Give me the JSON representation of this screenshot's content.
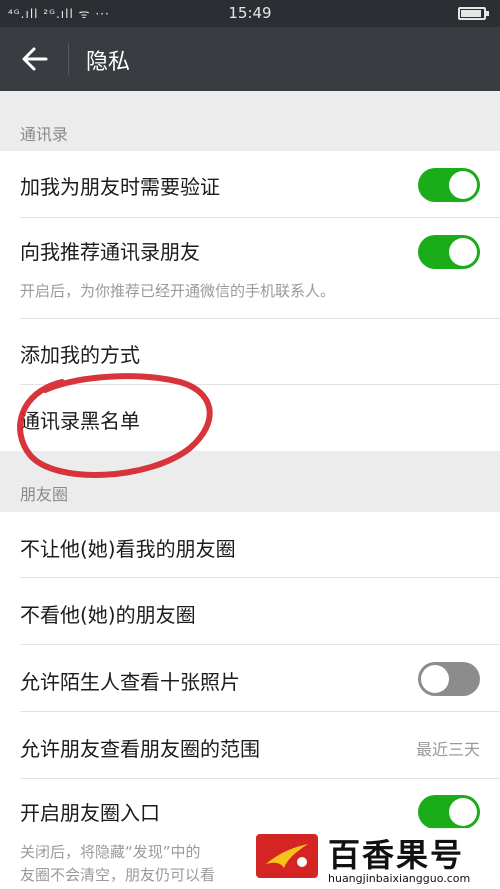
{
  "statusbar": {
    "signal_text": "⁴ᴳ.ıll ²ᴳ.ıll ᯤ ···",
    "time": "15:49"
  },
  "header": {
    "title": "隐私"
  },
  "sections": {
    "contacts": {
      "header": "通讯录",
      "items": [
        {
          "label": "加我为朋友时需要验证",
          "toggle": "on"
        },
        {
          "label": "向我推荐通讯录朋友",
          "toggle": "on",
          "sub": "开启后，为你推荐已经开通微信的手机联系人。"
        },
        {
          "label": "添加我的方式"
        },
        {
          "label": "通讯录黑名单"
        }
      ]
    },
    "moments": {
      "header": "朋友圈",
      "items": [
        {
          "label": "不让他(她)看我的朋友圈"
        },
        {
          "label": "不看他(她)的朋友圈"
        },
        {
          "label": "允许陌生人查看十张照片",
          "toggle": "off"
        },
        {
          "label": "允许朋友查看朋友圈的范围",
          "value": "最近三天"
        },
        {
          "label": "开启朋友圈入口",
          "toggle": "on",
          "sub1": "关闭后，将隐藏“发现”中的",
          "sub2": "友圈不会清空，朋友仍可以看"
        }
      ]
    }
  },
  "watermark": {
    "brand": "百香果号",
    "url": "huangjinbaixiangguo.com"
  },
  "colors": {
    "toggle_on": "#1aad19",
    "toggle_off": "#8c8c8c",
    "titlebar": "#393c40",
    "annotation": "#d4232a"
  }
}
